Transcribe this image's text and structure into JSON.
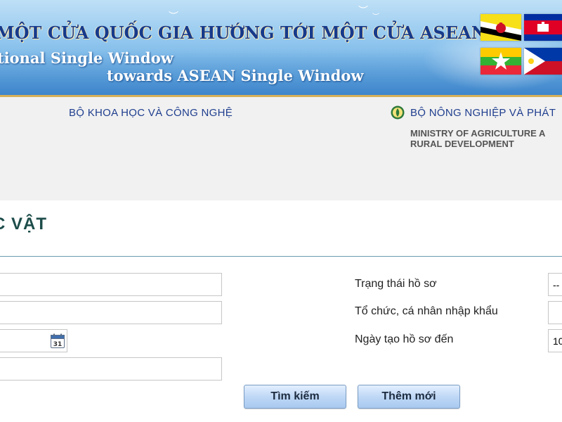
{
  "banner": {
    "title_vi": "MỘT CỬA QUỐC GIA HƯỚNG TỚI MỘT CỬA ASEAN",
    "line1": "tional Single Window",
    "line2": "towards ASEAN Single Window",
    "flags": [
      "brunei-flag",
      "cambodia-flag",
      "myanmar-flag",
      "philippines-flag"
    ]
  },
  "ministries": {
    "science_vi": "BỘ KHOA HỌC VÀ CÔNG NGHỆ",
    "agriculture_vi": "BỘ NÔNG NGHIỆP VÀ PHÁT",
    "agriculture_en_line1": "MINISTRY OF AGRICULTURE A",
    "agriculture_en_line2": "RURAL DEVELOPMENT"
  },
  "page": {
    "title": "C VẬT"
  },
  "form": {
    "status_label": "Trạng thái hồ sơ",
    "status_value": "--",
    "importer_label": "Tổ chức, cá nhân nhập khẩu",
    "date_to_label": "Ngày tạo hồ sơ đến",
    "date_to_value": "10",
    "calendar_day": "31",
    "search_label": "Tìm kiếm",
    "add_new_label": "Thêm mới"
  },
  "colors": {
    "title": "#1d4d4a",
    "ministry_link": "#1f3e8e",
    "button_fill": "#bcd6f5"
  }
}
